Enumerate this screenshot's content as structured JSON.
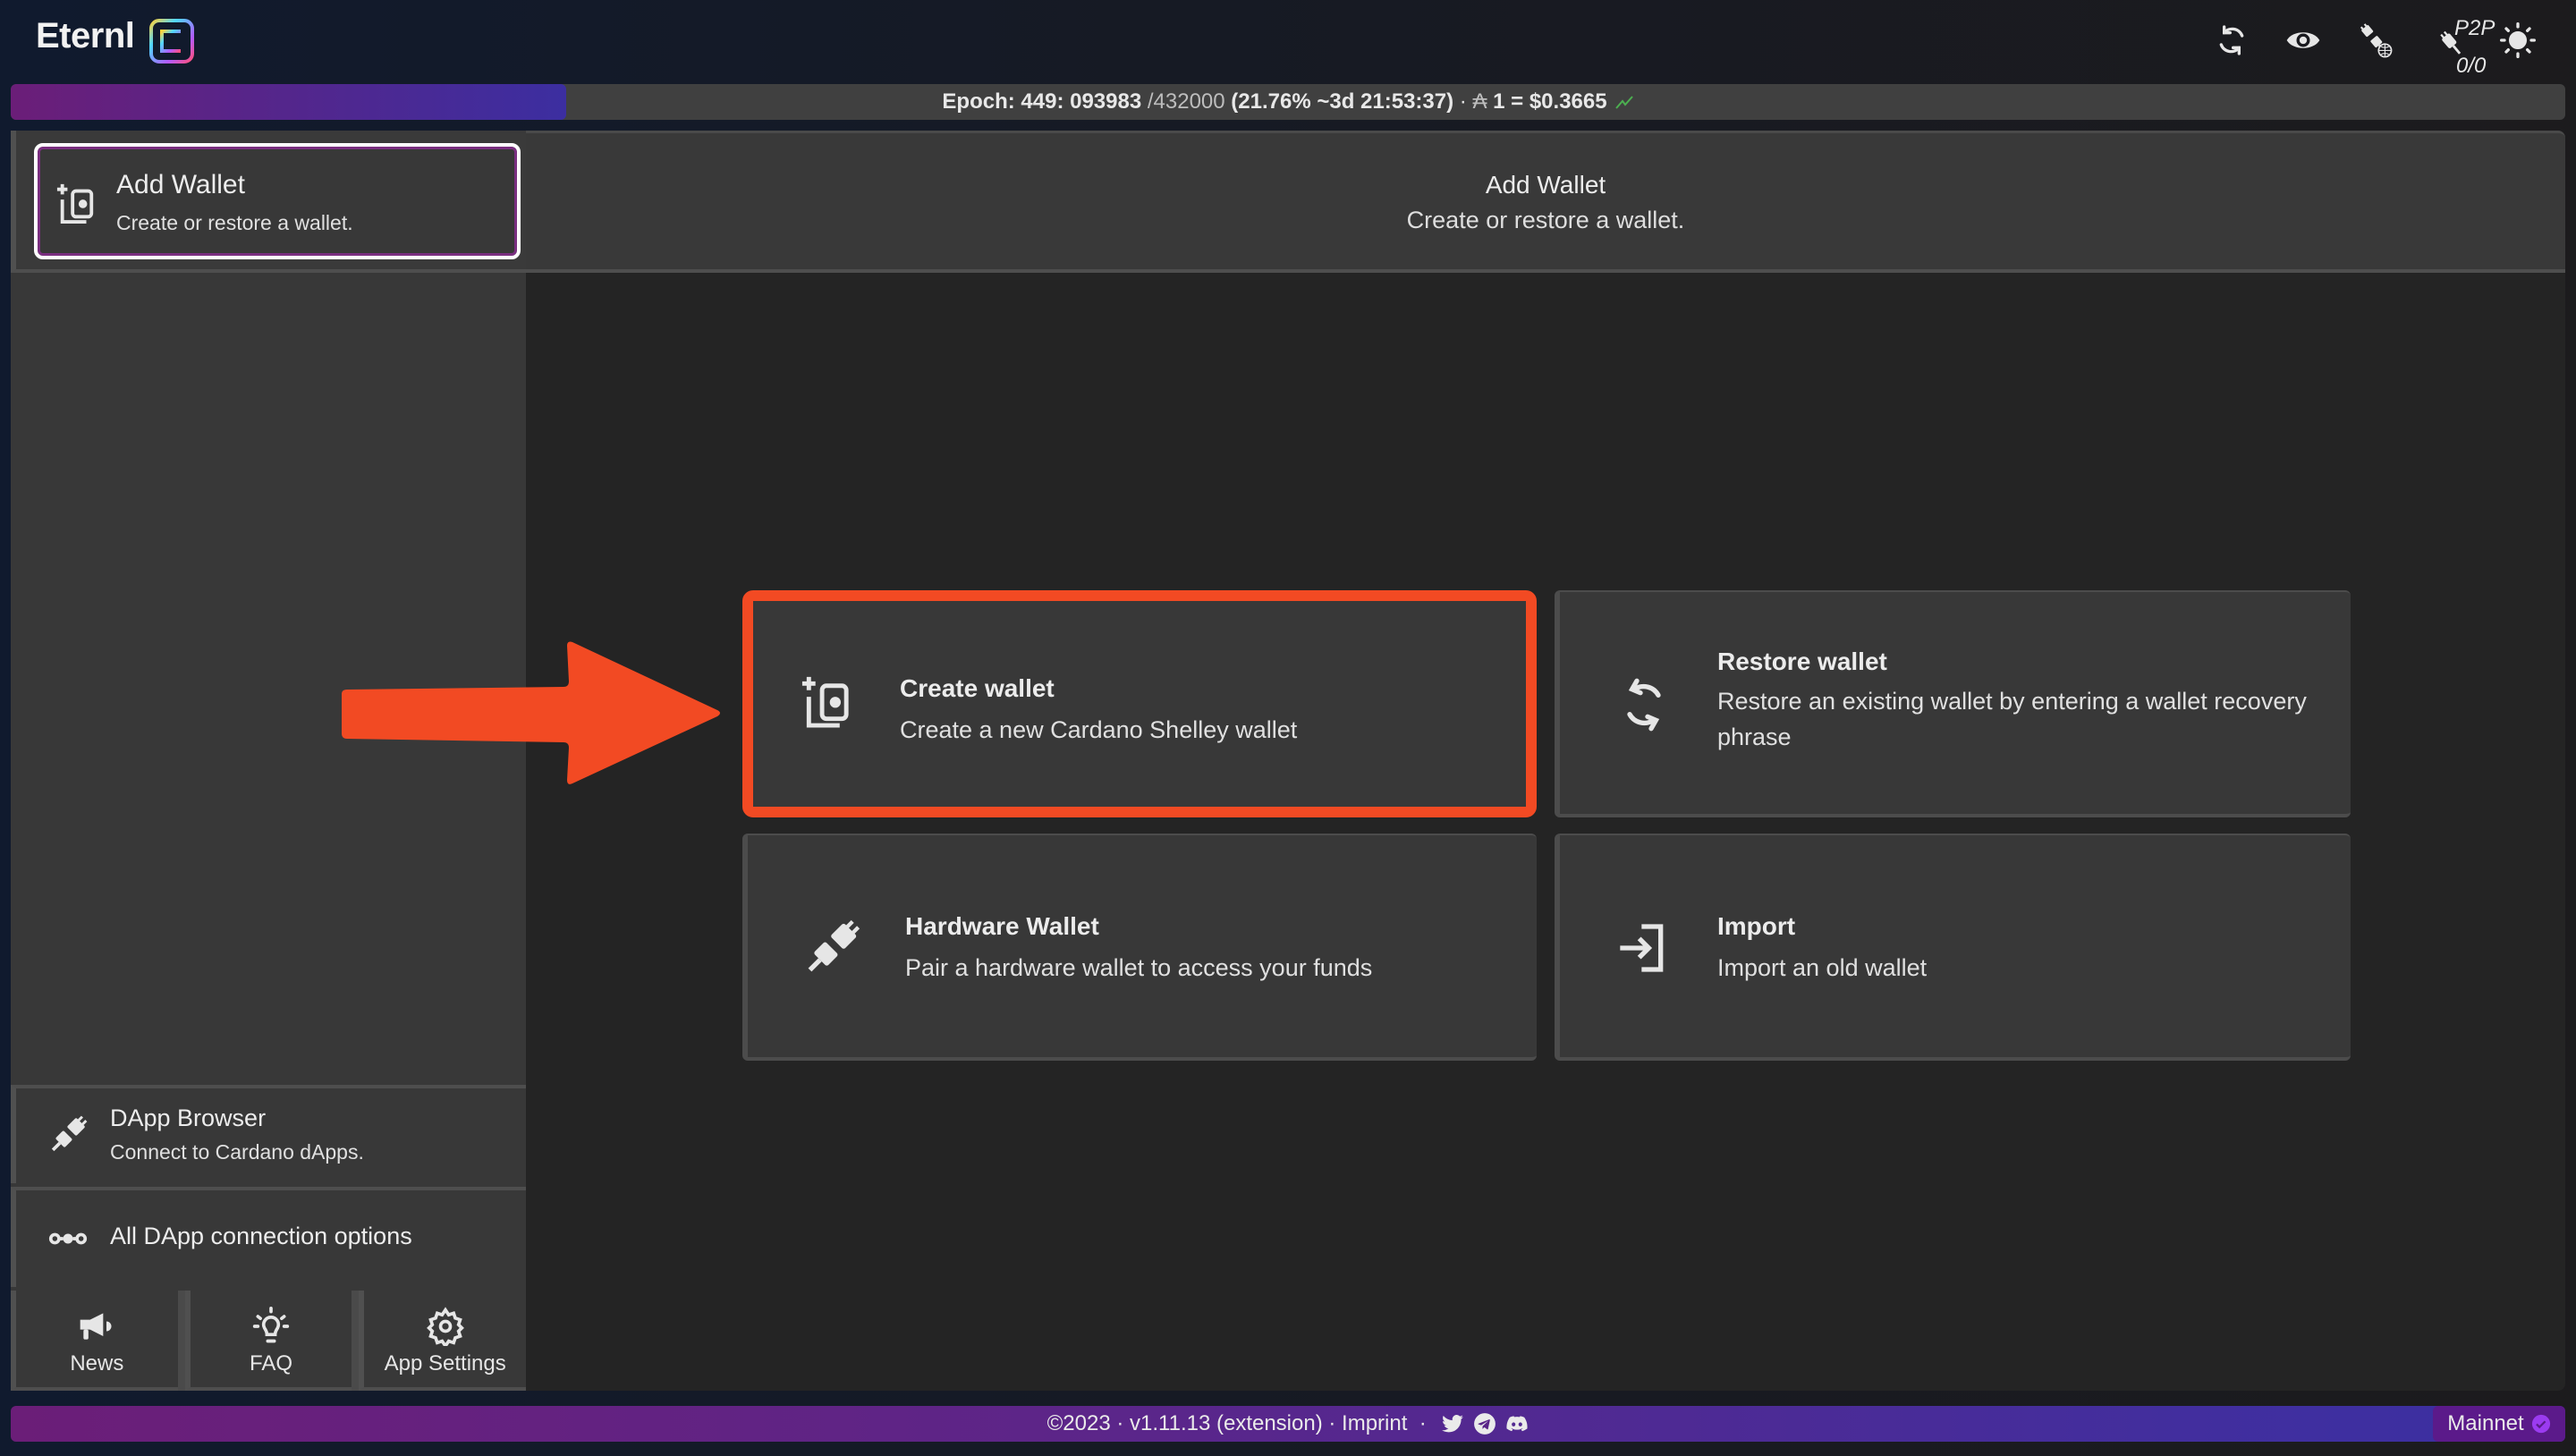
{
  "app": {
    "name": "Eternl"
  },
  "topbar": {
    "icons": [
      {
        "name": "sync-icon",
        "label": "Sync"
      },
      {
        "name": "eye-icon",
        "label": "Toggle privacy"
      },
      {
        "name": "dapp-connect-globe-icon",
        "label": "DApp connector"
      },
      {
        "name": "p2p-plug-icon",
        "label": "P2P"
      },
      {
        "name": "sun-icon",
        "label": "Theme"
      }
    ],
    "p2p_label": "P2P",
    "p2p_count": "0/0"
  },
  "epoch": {
    "label": "Epoch: 449: 093983 ",
    "slot_total": "/432000",
    "progress_text": " (21.76% ~3d 21:53:37) ",
    "separator": "· ",
    "ada_symbol": "₳",
    "price_text": " 1 = $0.3665",
    "progress_fraction": 0.2176,
    "trend_color": "#4caf50"
  },
  "sidebar": {
    "add_wallet": {
      "title": "Add Wallet",
      "subtitle": "Create or restore a wallet."
    },
    "dapp_browser": {
      "title": "DApp Browser",
      "subtitle": "Connect to Cardano dApps."
    },
    "dapp_options": {
      "title": "All DApp connection options"
    },
    "bottom_buttons": [
      {
        "label": "News",
        "icon": "megaphone-icon"
      },
      {
        "label": "FAQ",
        "icon": "lightbulb-icon"
      },
      {
        "label": "App Settings",
        "icon": "gear-icon"
      }
    ]
  },
  "main": {
    "header": {
      "title": "Add Wallet",
      "subtitle": "Create or restore a wallet."
    },
    "cards": [
      {
        "title": "Create wallet",
        "description": "Create a new Cardano Shelley wallet",
        "icon": "wallet-add-icon",
        "highlighted": true
      },
      {
        "title": "Restore wallet",
        "description": "Restore an existing wallet by entering a wallet recovery phrase",
        "icon": "restore-icon"
      },
      {
        "title": "Hardware Wallet",
        "description": "Pair a hardware wallet to access your funds",
        "icon": "plug-icon"
      },
      {
        "title": "Import",
        "description": "Import an old wallet",
        "icon": "import-icon"
      }
    ],
    "annotation": {
      "type": "arrow",
      "points_to": "Create wallet",
      "color": "#f24a23"
    }
  },
  "footer": {
    "copyright": "©2023 · v1.11.13 (extension) · ",
    "imprint": "Imprint",
    "separator": "  · ",
    "social": [
      "twitter-icon",
      "telegram-icon",
      "discord-icon"
    ],
    "network": "Mainnet"
  },
  "colors": {
    "accent_purple": "#6b1e78",
    "accent_indigo": "#3c2ea0",
    "highlight_red": "#f24a23",
    "sidebar_bg": "#383838",
    "main_bg": "#242424"
  }
}
